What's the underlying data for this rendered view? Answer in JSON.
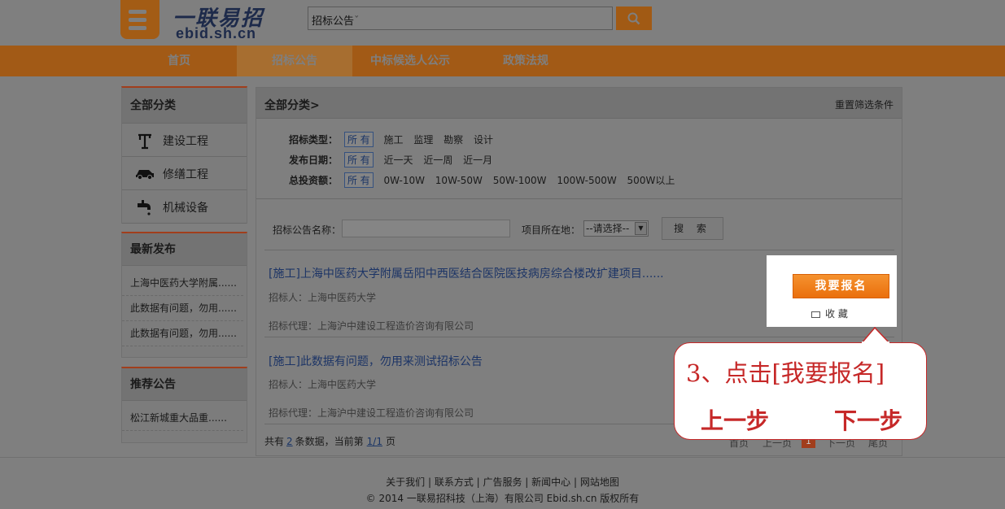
{
  "header": {
    "logo_cn": "一联易招",
    "logo_en": "ebid.sh.cn",
    "search_category": "招标公告",
    "search_arrow": "ˇ"
  },
  "nav": [
    {
      "label": "首页",
      "active": false
    },
    {
      "label": "招标公告",
      "active": true
    },
    {
      "label": "中标候选人公示",
      "active": false
    },
    {
      "label": "政策法规",
      "active": false
    }
  ],
  "sidebar": {
    "categories_title": "全部分类",
    "categories": [
      {
        "label": "建设工程",
        "icon": "crane-icon"
      },
      {
        "label": "修缮工程",
        "icon": "car-icon"
      },
      {
        "label": "机械设备",
        "icon": "faucet-icon"
      }
    ],
    "latest_title": "最新发布",
    "latest": [
      "上海中医药大学附属......",
      "此数据有问题，勿用......",
      "此数据有问题，勿用......"
    ],
    "recommend_title": "推荐公告",
    "recommend": [
      "松江新城重大品重......"
    ]
  },
  "main": {
    "breadcrumb": "全部分类>",
    "reset": "重置筛选条件",
    "filters": [
      {
        "label": "招标类型：",
        "options": [
          "所 有",
          "施工",
          "监理",
          "勘察",
          "设计"
        ]
      },
      {
        "label": "发布日期：",
        "options": [
          "所 有",
          "近一天",
          "近一周",
          "近一月"
        ]
      },
      {
        "label": "总投资额：",
        "options": [
          "所 有",
          "0W-10W",
          "10W-50W",
          "50W-100W",
          "100W-500W",
          "500W以上"
        ]
      }
    ],
    "name_label": "招标公告名称：",
    "location_label": "项目所在地：",
    "location_value": "--请选择--",
    "search_button": "搜 索",
    "items": [
      {
        "title": "[施工]上海中医药大学附属岳阳中西医结合医院医技病房综合楼改扩建项目......",
        "tenderer": "招标人：上海中医药大学",
        "agent": "招标代理：上海沪中建设工程造价咨询有限公司"
      },
      {
        "title": "[施工]此数据有问题，勿用来测试招标公告",
        "tenderer": "招标人：上海中医药大学",
        "agent": "招标代理：上海沪中建设工程造价咨询有限公司"
      }
    ],
    "pager": {
      "prefix": "共有",
      "total": "2",
      "mid": "条数据，当前第",
      "page": "1/1",
      "suffix": "页",
      "first": "首页",
      "prev": "上一页",
      "current": "1",
      "next": "下一页",
      "last": "尾页"
    },
    "apply_button": "我要报名",
    "favorite": "收 藏"
  },
  "callout": {
    "step": "3、点击[我要报名]",
    "prev": "上一步",
    "next": "下一步"
  },
  "footer": {
    "links": "关于我们 | 联系方式 | 广告服务 | 新闻中心 | 网站地图",
    "copyright": "© 2014 一联易招科技（上海）有限公司 Ebid.sh.cn 版权所有"
  }
}
